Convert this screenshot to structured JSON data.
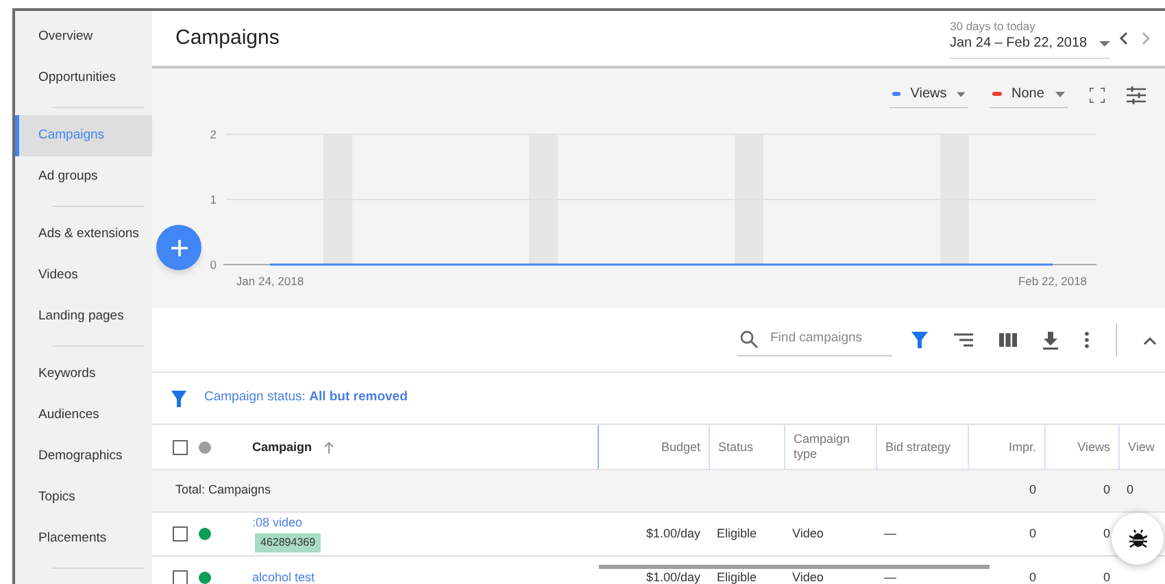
{
  "sidebar": {
    "groups": [
      [
        {
          "label": "Overview",
          "selected": false
        },
        {
          "label": "Opportunities",
          "selected": false
        }
      ],
      [
        {
          "label": "Campaigns",
          "selected": true
        },
        {
          "label": "Ad groups",
          "selected": false
        }
      ],
      [
        {
          "label": "Ads & extensions",
          "selected": false
        },
        {
          "label": "Videos",
          "selected": false
        },
        {
          "label": "Landing pages",
          "selected": false
        }
      ],
      [
        {
          "label": "Keywords",
          "selected": false
        },
        {
          "label": "Audiences",
          "selected": false
        },
        {
          "label": "Demographics",
          "selected": false
        },
        {
          "label": "Topics",
          "selected": false
        },
        {
          "label": "Placements",
          "selected": false
        }
      ]
    ]
  },
  "header": {
    "title": "Campaigns",
    "date_caption": "30 days to today",
    "date_range": "Jan 24 – Feb 22, 2018"
  },
  "chart": {
    "metrics": [
      {
        "label": "Views",
        "color": "#4285f4"
      },
      {
        "label": "None",
        "color": "#ea4335"
      }
    ],
    "chart_data": {
      "type": "line",
      "categories": [
        "Jan 24, 2018",
        "Feb 22, 2018"
      ],
      "series": [
        {
          "color": "#4285f4",
          "values": [
            0,
            0
          ]
        }
      ],
      "ylim": [
        0,
        2
      ],
      "yticks": [
        0,
        1,
        2
      ]
    }
  },
  "toolbar": {
    "search_placeholder": "Find campaigns"
  },
  "filter": {
    "text": "Campaign status: **All but removed**"
  },
  "table": {
    "header_checked": false,
    "columns": [
      {
        "label": "Campaign",
        "sorted": true
      },
      {
        "label": "Budget",
        "sorted": false
      },
      {
        "label": "Status",
        "sorted": false
      },
      {
        "label": "Campaign type",
        "sorted": false
      },
      {
        "label": "Bid strategy",
        "sorted": false
      },
      {
        "label": "Impr.",
        "sorted": false
      },
      {
        "label": "Views",
        "sorted": false
      },
      {
        "label": "View",
        "sorted": false
      }
    ],
    "total": {
      "label": "Total: Campaigns",
      "cells": [
        "",
        "",
        "",
        "",
        "0",
        "0",
        "0"
      ]
    },
    "rows": [
      {
        "checked": false,
        "color": "#0f9d58",
        "id": "462894369",
        "cells": [
          ":08 video",
          "$1.00/day",
          "Eligible",
          "Video",
          "—",
          "0",
          "0",
          ""
        ]
      },
      {
        "checked": false,
        "color": "#0f9d58",
        "cells": [
          "alcohol test",
          "$1.00/day",
          "Eligible",
          "Video",
          "—",
          "0",
          "0",
          ""
        ]
      }
    ]
  }
}
